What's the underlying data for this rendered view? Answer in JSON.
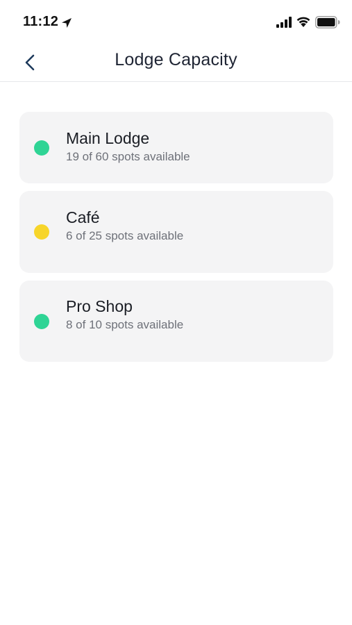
{
  "status_bar": {
    "time": "11:12",
    "icons": [
      "location-arrow-icon",
      "cellular-signal-icon",
      "wifi-icon",
      "battery-icon"
    ]
  },
  "nav": {
    "back_icon": "chevron-left-icon",
    "title": "Lodge Capacity"
  },
  "colors": {
    "available_green": "#2fd495",
    "limited_yellow": "#f7d52a",
    "card_background": "#f4f4f5",
    "title_text": "#1e2433",
    "detail_text": "#6e7179"
  },
  "lodges": [
    {
      "name": "Main Lodge",
      "detail": "19 of 60 spots available",
      "status_color": "#2fd495"
    },
    {
      "name": "Café",
      "detail": "6 of 25 spots available",
      "status_color": "#f7d52a"
    },
    {
      "name": "Pro Shop",
      "detail": "8 of 10 spots available",
      "status_color": "#2fd495"
    }
  ]
}
